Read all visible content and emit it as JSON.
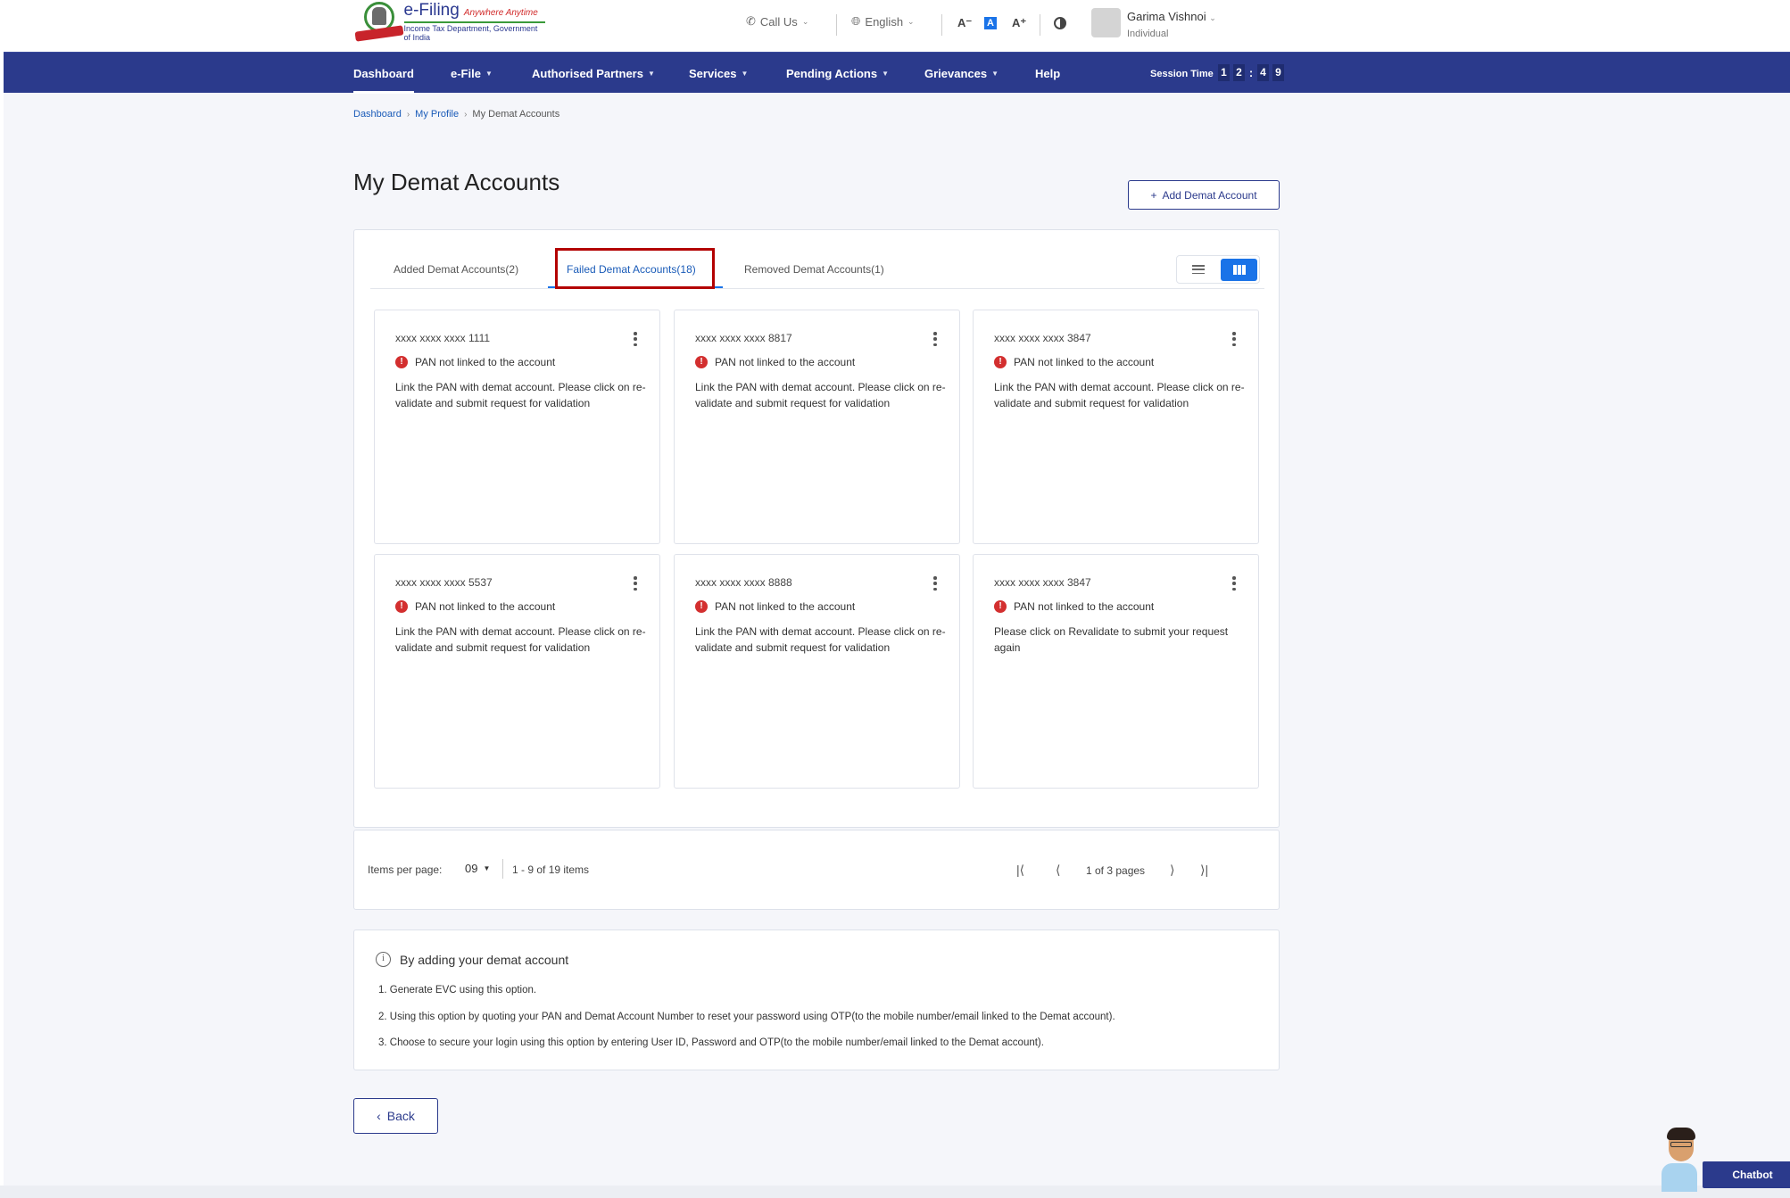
{
  "header": {
    "logo_title": "e-Filing",
    "logo_tagline": "Anywhere Anytime",
    "logo_subtitle": "Income Tax Department, Government of India",
    "call_us": "Call Us",
    "language": "English",
    "font_decrease": "A⁻",
    "font_default": "A",
    "font_increase": "A⁺",
    "user_name": "Garima Vishnoi",
    "user_role": "Individual"
  },
  "nav": {
    "items": [
      {
        "label": "Dashboard",
        "dropdown": false
      },
      {
        "label": "e-File",
        "dropdown": true
      },
      {
        "label": "Authorised Partners",
        "dropdown": true
      },
      {
        "label": "Services",
        "dropdown": true
      },
      {
        "label": "Pending Actions",
        "dropdown": true
      },
      {
        "label": "Grievances",
        "dropdown": true
      },
      {
        "label": "Help",
        "dropdown": false
      }
    ],
    "session_label": "Session Time",
    "session_digits": [
      "1",
      "2",
      "4",
      "9"
    ]
  },
  "breadcrumb": {
    "items": [
      "Dashboard",
      "My Profile"
    ],
    "current": "My Demat Accounts"
  },
  "page": {
    "title": "My Demat Accounts",
    "add_button": "Add Demat Account",
    "add_icon": "+"
  },
  "tabs": [
    {
      "label": "Added Demat Accounts(2)",
      "active": false
    },
    {
      "label": "Failed Demat Accounts(18)",
      "active": true
    },
    {
      "label": "Removed Demat Accounts(1)",
      "active": false
    }
  ],
  "view_mode": "grid",
  "cards": [
    {
      "number": "xxxx xxxx xxxx 1111",
      "status": "PAN not linked to the account",
      "description": "Link the PAN with demat account. Please click on re-validate and submit request for validation"
    },
    {
      "number": "xxxx xxxx xxxx 8817",
      "status": "PAN not linked to the account",
      "description": "Link the PAN with demat account. Please click on re-validate and submit request for validation"
    },
    {
      "number": "xxxx xxxx xxxx 3847",
      "status": "PAN not linked to the account",
      "description": "Link the PAN with demat account. Please click on re-validate and submit request for validation"
    },
    {
      "number": "xxxx xxxx xxxx 5537",
      "status": "PAN not linked to the account",
      "description": "Link the PAN with demat account. Please click on re-validate and submit request for validation"
    },
    {
      "number": "xxxx xxxx xxxx 8888",
      "status": "PAN not linked to the account",
      "description": "Link the PAN with demat account. Please click on re-validate and submit request for validation"
    },
    {
      "number": "xxxx xxxx xxxx 3847",
      "status": "PAN not linked to the account",
      "description": "Please click on Revalidate to submit your request again"
    }
  ],
  "pagination": {
    "items_per_page_label": "Items per page:",
    "items_per_page": "09",
    "range": "1 - 9 of 19 items",
    "page_text": "1 of 3 pages"
  },
  "info": {
    "title": "By adding your demat account",
    "lines": [
      "1. Generate EVC using this option.",
      "2. Using this option by quoting your PAN and Demat Account Number to reset your password using OTP(to the mobile number/email linked to the Demat account).",
      "3. Choose to secure your login using this option by entering User ID, Password and OTP(to the mobile number/email linked to the Demat account)."
    ]
  },
  "back_button": "Back",
  "chatbot_label": "Chatbot",
  "colors": {
    "brand": "#2b3a8c",
    "accent": "#1a73e8",
    "error": "#d32f2f",
    "highlight": "#b30000"
  }
}
